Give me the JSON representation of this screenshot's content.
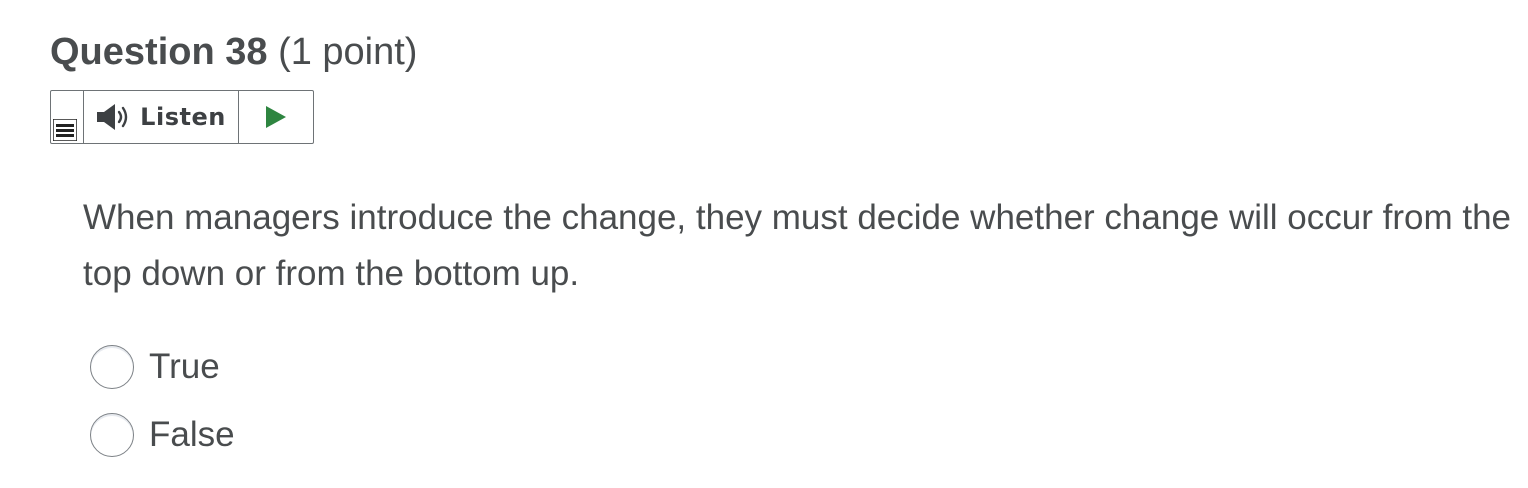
{
  "question": {
    "title": "Question 38",
    "points": "(1 point)",
    "text": "When managers introduce the change, they must decide whether change will occur from the top down or from the bottom up."
  },
  "listen_widget": {
    "label": "Listen",
    "menu_icon": "menu-lines-icon",
    "speaker_icon": "speaker-icon",
    "play_icon": "play-icon",
    "play_color": "#2e8540"
  },
  "options": [
    {
      "label": "True",
      "selected": false
    },
    {
      "label": "False",
      "selected": false
    }
  ]
}
